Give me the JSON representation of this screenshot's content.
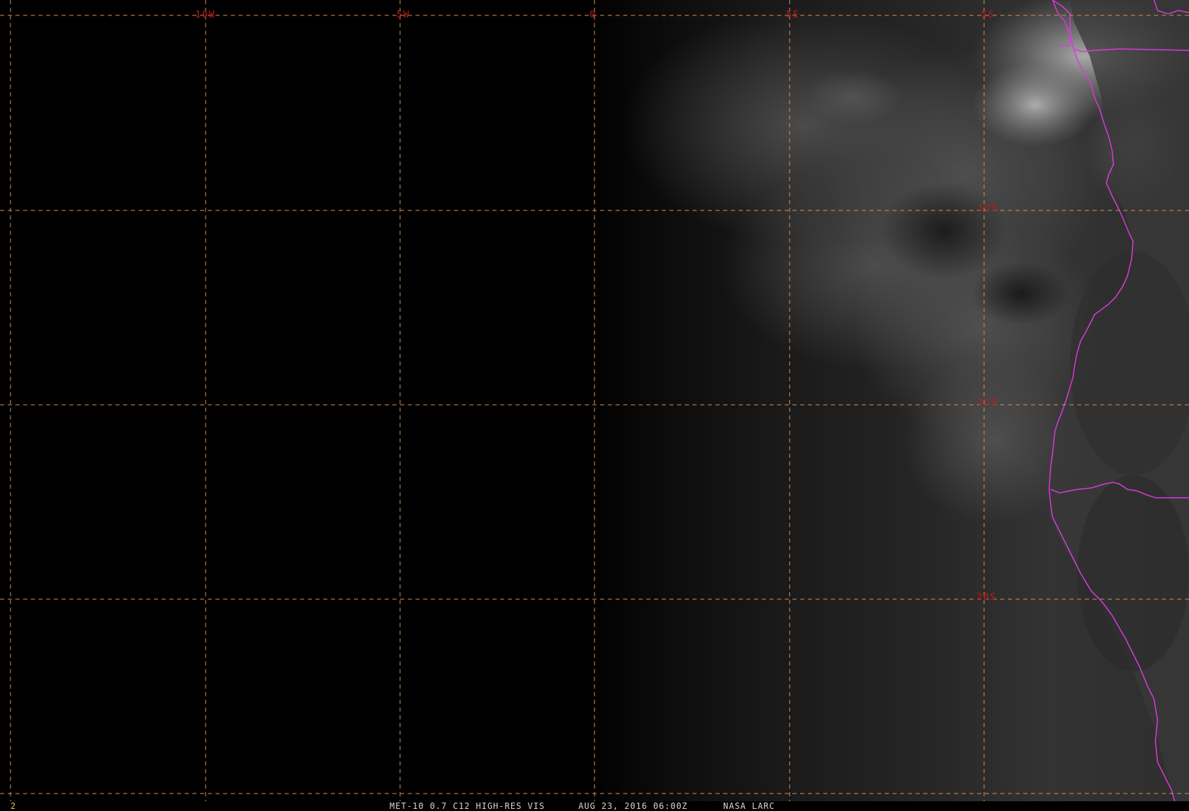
{
  "colors": {
    "background": "#000000",
    "gridline": "#d98f55",
    "grid_label": "#c61818",
    "coastline": "#d93ad9",
    "status_text": "#d6d6d6",
    "frame_number": "#d9c531"
  },
  "map": {
    "projection_grid_step_deg": 5,
    "lon_labels": [
      "10W",
      "5W",
      "0",
      "5E",
      "5S"
    ],
    "lat_labels": [
      "10S",
      "15S",
      "20S"
    ]
  },
  "status": {
    "frame_number": "2",
    "satellite_product": "MET-10 0.7 C12 HIGH-RES VIS",
    "timestamp": "AUG 23, 2016 06:00Z",
    "source": "NASA LARC"
  }
}
